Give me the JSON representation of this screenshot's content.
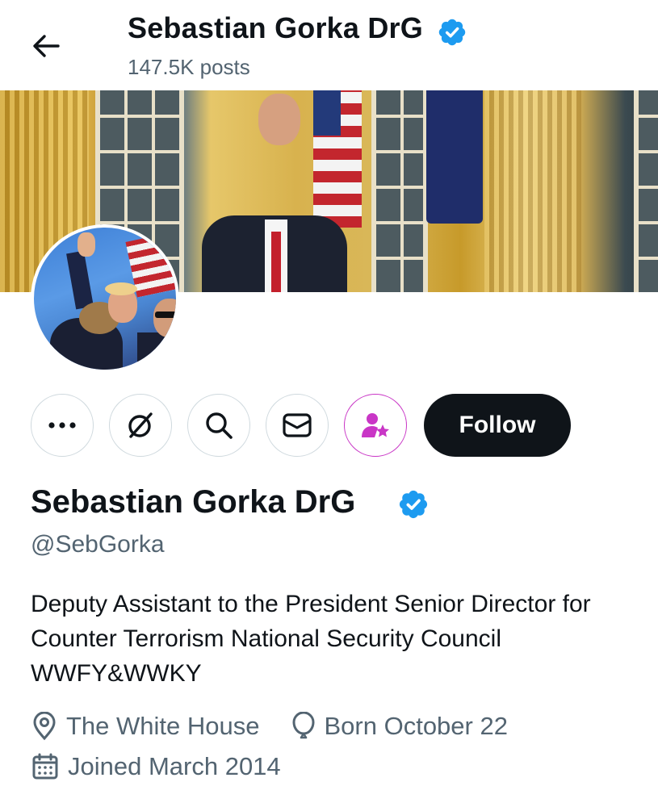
{
  "header": {
    "title": "Sebastian Gorka DrG",
    "post_count": "147.5K posts"
  },
  "colors": {
    "verified_badge": "#1d9bf0",
    "subscribe_accent": "#c936c6",
    "follow_button_bg": "#0f1419",
    "secondary_text": "#536471"
  },
  "icons": {
    "back": "arrow-left-icon",
    "verified": "verified-badge-icon",
    "more": "more-horizontal-icon",
    "grok": "grok-icon",
    "search": "search-icon",
    "message": "message-icon",
    "subscribe": "subscribe-icon",
    "location": "location-pin-icon",
    "birthday": "balloon-icon",
    "joined": "calendar-icon"
  },
  "actions": {
    "follow_label": "Follow"
  },
  "profile": {
    "display_name": "Sebastian Gorka DrG",
    "handle": "@SebGorka",
    "bio": "Deputy Assistant to the President Senior Director for Counter Terrorism National Security Council WWFY&WWKY",
    "location": "The White House",
    "birthday": "Born October 22",
    "joined": "Joined March 2014"
  }
}
